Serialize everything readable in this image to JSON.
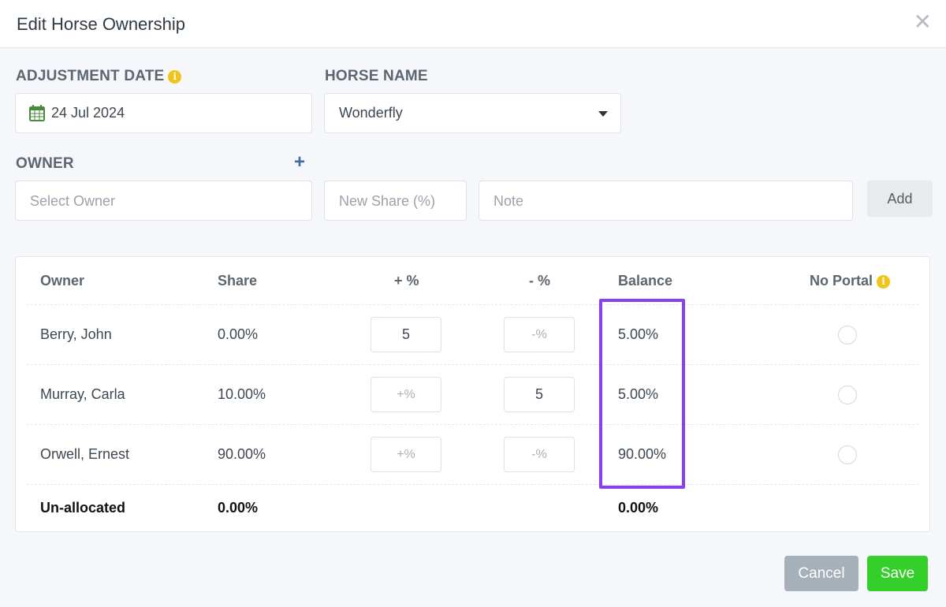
{
  "modal": {
    "title": "Edit Horse Ownership",
    "close_icon": "close-icon"
  },
  "form": {
    "adjustment_date_label": "ADJUSTMENT DATE",
    "adjustment_date_value": "24 Jul 2024",
    "horse_name_label": "HORSE NAME",
    "horse_name_value": "Wonderfly",
    "owner_label": "OWNER",
    "owner_placeholder": "Select Owner",
    "new_share_placeholder": "New Share (%)",
    "note_placeholder": "Note",
    "add_label": "Add"
  },
  "table": {
    "headers": {
      "owner": "Owner",
      "share": "Share",
      "plus": "+ %",
      "minus": "- %",
      "balance": "Balance",
      "no_portal": "No Portal"
    },
    "rows": [
      {
        "owner": "Berry, John",
        "share": "0.00%",
        "plus": "5",
        "plus_placeholder": "+%",
        "minus": "",
        "minus_placeholder": "-%",
        "balance": "5.00%",
        "no_portal": false
      },
      {
        "owner": "Murray, Carla",
        "share": "10.00%",
        "plus": "",
        "plus_placeholder": "+%",
        "minus": "5",
        "minus_placeholder": "-%",
        "balance": "5.00%",
        "no_portal": false
      },
      {
        "owner": "Orwell, Ernest",
        "share": "90.00%",
        "plus": "",
        "plus_placeholder": "+%",
        "minus": "",
        "minus_placeholder": "-%",
        "balance": "90.00%",
        "no_portal": false
      }
    ],
    "footer": {
      "label": "Un-allocated",
      "share": "0.00%",
      "balance": "0.00%"
    }
  },
  "actions": {
    "cancel_label": "Cancel",
    "save_label": "Save"
  },
  "colors": {
    "save": "#34cf29",
    "cancel": "#a6b0b9",
    "highlight": "#8a3ff0",
    "info": "#f0c419",
    "plus_icon": "#3b6ea8"
  }
}
